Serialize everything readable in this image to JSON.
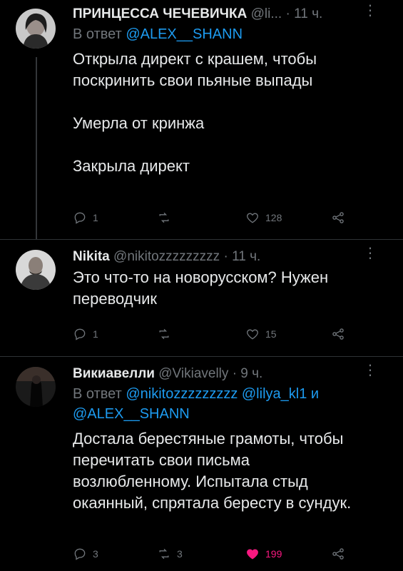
{
  "tweets": [
    {
      "name": "ПРИНЦЕССА ЧЕЧЕВИЧКА",
      "handle": "@li...",
      "dot": "·",
      "time": "11 ч.",
      "reply_prefix": "В ответ",
      "reply_mentions": "@ALEX__SHANN",
      "text": "Открыла директ с крашем, чтобы\nпоскринить свои пьяные выпады\n\nУмерла от кринжа\n\nЗакрыла директ",
      "replies": "1",
      "retweets": "",
      "likes": "128"
    },
    {
      "name": "Nikita",
      "handle": "@nikitozzzzzzzzz",
      "dot": "·",
      "time": "11 ч.",
      "text": "Это что-то на новорусском? Нужен\nпереводчик",
      "replies": "1",
      "retweets": "",
      "likes": "15"
    },
    {
      "name": "Викиавелли",
      "handle": "@Vikiavelly",
      "dot": "·",
      "time": "9 ч.",
      "reply_prefix": "В ответ",
      "reply_mentions_line1": "@nikitozzzzzzzzz @lilya_kl1 и",
      "reply_mentions_line2": "@ALEX__SHANN",
      "text": "Достала берестяные грамоты, чтобы\nперечитать свои письма\nвозлюбленному. Испытала стыд\nокаянный, спрятала бересту в сундук.",
      "replies": "3",
      "retweets": "3",
      "likes": "199"
    }
  ],
  "colors": {
    "bg": "#000000",
    "text": "#e7e9ea",
    "muted": "#71767b",
    "link": "#1d9bf0",
    "like": "#f91880"
  },
  "icons": [
    "reply-icon",
    "retweet-icon",
    "like-icon",
    "share-icon",
    "more-icon"
  ]
}
